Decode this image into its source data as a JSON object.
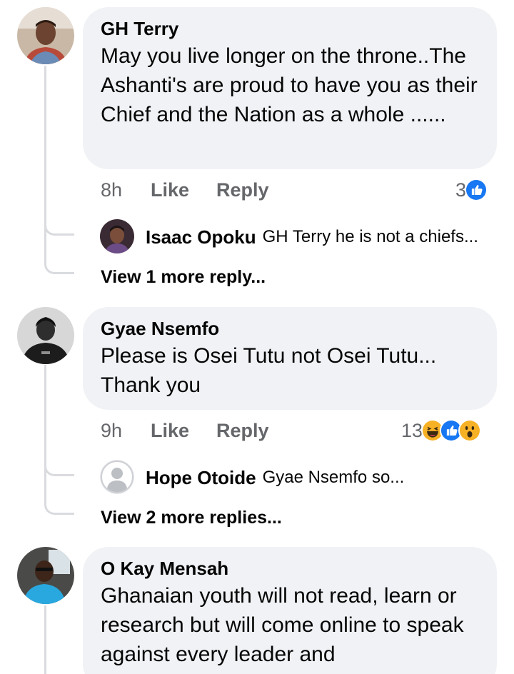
{
  "comments": [
    {
      "author": "GH Terry",
      "text": "May you live longer on the throne..The Ashanti's are proud to have you as their Chief and the Nation as a whole ......",
      "time": "8h",
      "like_label": "Like",
      "reply_label": "Reply",
      "reaction_count": "3",
      "reactions": [
        "like-icon"
      ],
      "reply_preview": {
        "author": "Isaac Opoku",
        "text": "GH Terry he is not a chiefs..."
      },
      "more_replies": "View 1 more reply..."
    },
    {
      "author": "Gyae Nsemfo",
      "text": "Please is Osei Tutu not Osei Tutu... Thank you",
      "time": "9h",
      "like_label": "Like",
      "reply_label": "Reply",
      "reaction_count": "13",
      "reactions": [
        "haha-icon",
        "like-icon",
        "wow-icon"
      ],
      "reply_preview": {
        "author": "Hope Otoide",
        "text": "Gyae Nsemfo so..."
      },
      "more_replies": "View 2 more replies..."
    },
    {
      "author": "O Kay Mensah",
      "text": "Ghanaian youth will not read, learn or research but will come online to speak against every leader and"
    }
  ],
  "colors": {
    "bubble": "#f0f2f5",
    "meta": "#65676b",
    "like_blue": "#1877f2",
    "emoji_yellow": "#f7b125"
  }
}
